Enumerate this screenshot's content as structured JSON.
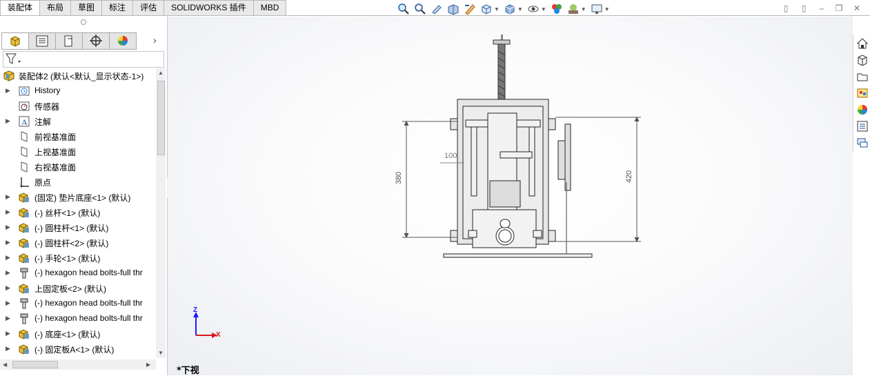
{
  "tabs": [
    {
      "label": "装配体",
      "active": true
    },
    {
      "label": "布局",
      "active": false
    },
    {
      "label": "草图",
      "active": false
    },
    {
      "label": "标注",
      "active": false
    },
    {
      "label": "评估",
      "active": false
    },
    {
      "label": "SOLIDWORKS 插件",
      "active": false
    },
    {
      "label": "MBD",
      "active": false
    }
  ],
  "tree": {
    "root": "装配体2 (默认<默认_显示状态-1>)",
    "items": [
      {
        "label": "History",
        "icon": "history-icon",
        "expandable": true
      },
      {
        "label": "传感器",
        "icon": "sensor-icon",
        "expandable": false
      },
      {
        "label": "注解",
        "icon": "annotation-icon",
        "expandable": true
      },
      {
        "label": "前视基准面",
        "icon": "plane-icon",
        "expandable": false
      },
      {
        "label": "上视基准面",
        "icon": "plane-icon",
        "expandable": false
      },
      {
        "label": "右视基准面",
        "icon": "plane-icon",
        "expandable": false
      },
      {
        "label": "原点",
        "icon": "origin-icon",
        "expandable": false
      },
      {
        "label": "(固定) 垫片底座<1> (默认)",
        "icon": "part-icon",
        "expandable": true
      },
      {
        "label": "(-) 丝杆<1> (默认)",
        "icon": "part-icon",
        "expandable": true
      },
      {
        "label": "(-) 圆柱杆<1> (默认)",
        "icon": "part-icon",
        "expandable": true
      },
      {
        "label": "(-) 圆柱杆<2> (默认)",
        "icon": "part-icon",
        "expandable": true
      },
      {
        "label": "(-) 手轮<1> (默认)",
        "icon": "part-icon",
        "expandable": true
      },
      {
        "label": "(-) hexagon head bolts-full thr",
        "icon": "bolt-icon",
        "expandable": true
      },
      {
        "label": "上固定板<2> (默认)",
        "icon": "part-icon",
        "expandable": true
      },
      {
        "label": "(-) hexagon head bolts-full thr",
        "icon": "bolt-icon",
        "expandable": true
      },
      {
        "label": "(-) hexagon head bolts-full thr",
        "icon": "bolt-icon",
        "expandable": true
      },
      {
        "label": "(-) 底座<1> (默认)",
        "icon": "part-icon",
        "expandable": true
      },
      {
        "label": "(-) 固定板A<1> (默认)",
        "icon": "part-icon",
        "expandable": true
      }
    ]
  },
  "model": {
    "dim_left": "380",
    "dim_right": "420",
    "dim_small": "100"
  },
  "triad": {
    "z": "Z",
    "x": "X"
  },
  "view_label": "*下视",
  "colors": {
    "accent": "#1f5aa6",
    "part_yellow": "#e8c33a",
    "triad_z": "#1a1aff",
    "triad_x": "#d61818"
  }
}
